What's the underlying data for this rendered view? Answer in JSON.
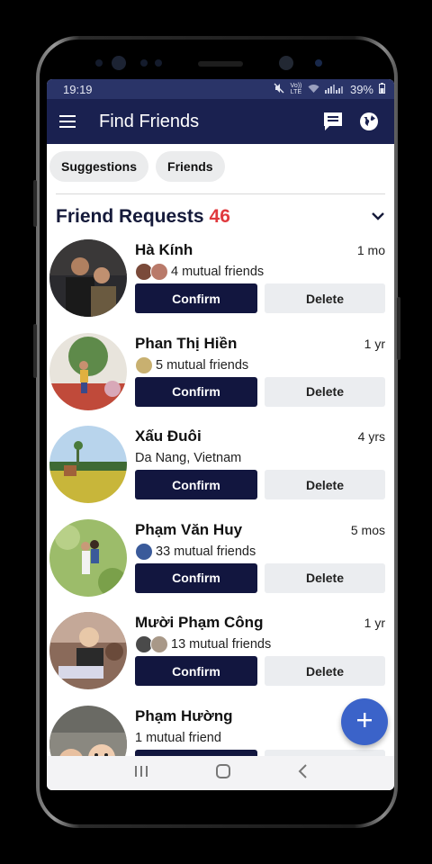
{
  "status_bar": {
    "time": "19:19",
    "network_label": "Vo)) LTE",
    "battery": "39%"
  },
  "app_bar": {
    "title": "Find Friends"
  },
  "chips": [
    {
      "label": "Suggestions"
    },
    {
      "label": "Friends"
    }
  ],
  "requests_section": {
    "label": "Friend Requests",
    "count": "46"
  },
  "buttons": {
    "confirm": "Confirm",
    "delete": "Delete"
  },
  "requests": [
    {
      "name": "Hà Kính",
      "time": "1 mo",
      "subtitle": "4 mutual friends"
    },
    {
      "name": "Phan Thị Hiền",
      "time": "1 yr",
      "subtitle": "5 mutual friends"
    },
    {
      "name": "Xấu Đuôi",
      "time": "4 yrs",
      "subtitle": "Da Nang, Vietnam"
    },
    {
      "name": "Phạm Văn Huy",
      "time": "5 mos",
      "subtitle": "33 mutual friends"
    },
    {
      "name": "Mười Phạm Công",
      "time": "1 yr",
      "subtitle": "13 mutual friends"
    },
    {
      "name": "Phạm Hường",
      "time": "",
      "subtitle": "1 mutual friend"
    }
  ],
  "colors": {
    "app_bar": "#1a2150",
    "count_red": "#e0393e",
    "confirm_bg": "#12163f",
    "fab": "#3b63c9"
  },
  "icons": [
    "menu-icon",
    "messenger-icon",
    "globe-icon",
    "chevron-down-icon",
    "plus-icon",
    "recents-icon",
    "home-icon",
    "back-icon"
  ]
}
